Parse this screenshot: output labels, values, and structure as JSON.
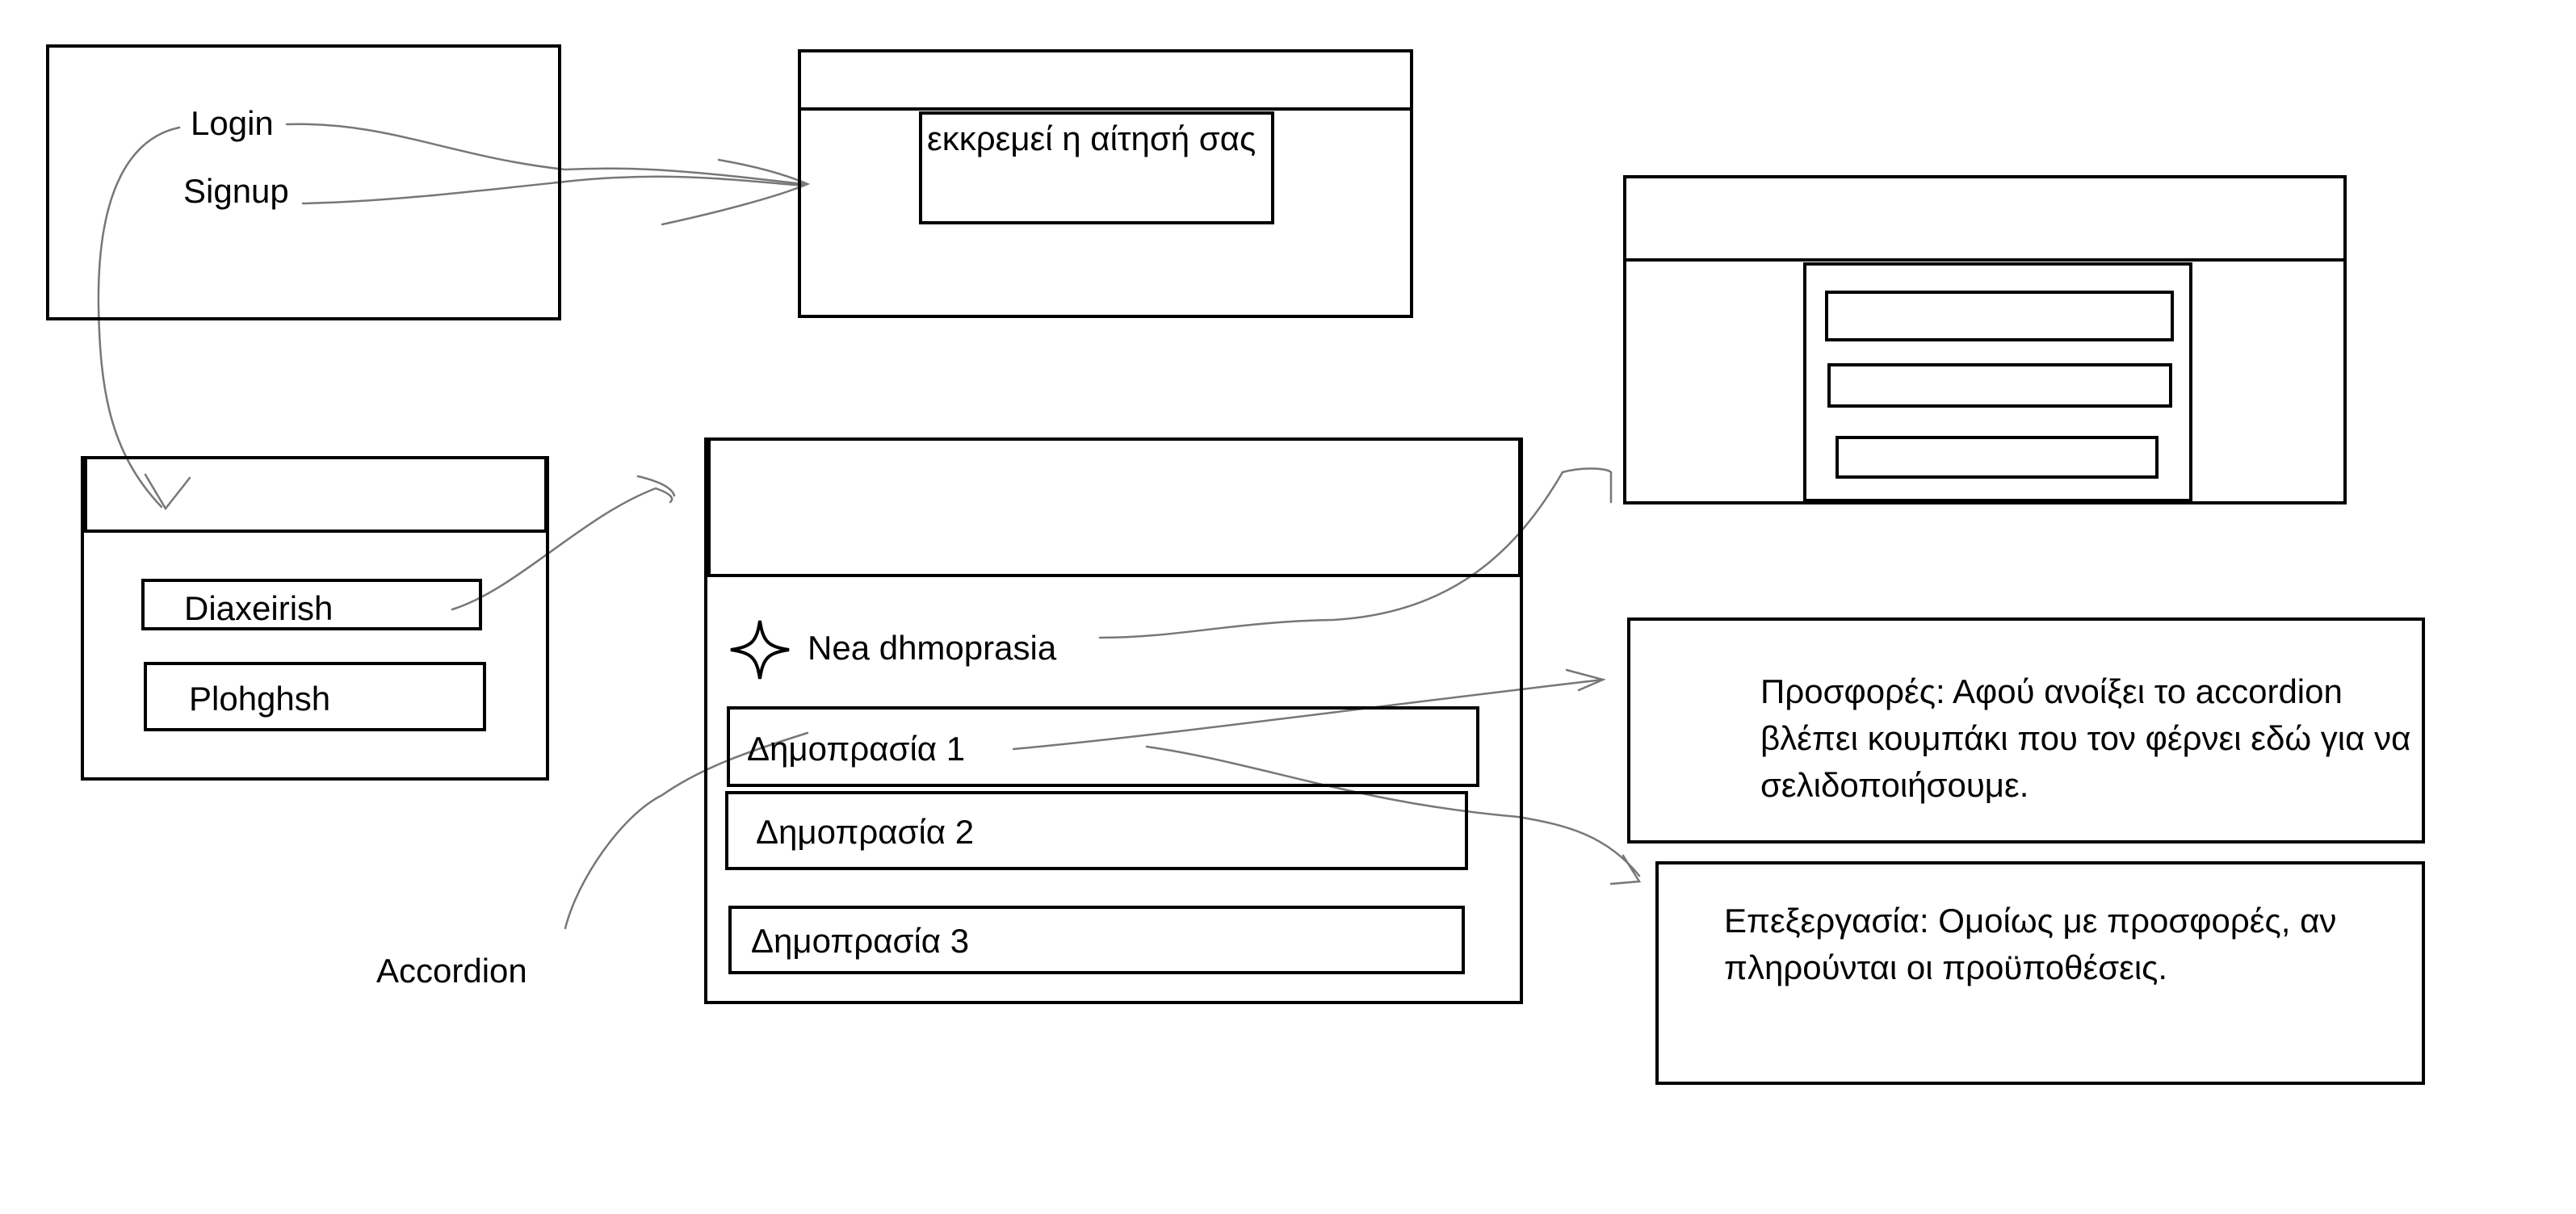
{
  "start_screen": {
    "login_label": "Login",
    "signup_label": "Signup"
  },
  "pending_screen": {
    "pending_message": "εκκρεμεί η αίτησή σας"
  },
  "role_screen": {
    "admin_button": "Diaxeirish",
    "browse_button": "Plohghsh"
  },
  "auction_screen": {
    "new_auction_label": "Nea dhmoprasia",
    "new_auction_icon": "sparkle-icon",
    "accordion_items": [
      "Δημοπρασία 1",
      "Δημοπρασία 2",
      "Δημοπρασία 3"
    ],
    "accordion_annotation": "Accordion"
  },
  "notes": {
    "offers_note": [
      "Προσφορές: Αφού ανοίξει το accordion",
      "βλέπει κουμπάκι που τον φέρνει εδώ για να",
      "σελιδοποιήσουμε."
    ],
    "edit_note": [
      "Επεξεργασία: Ομοίως με προσφορές, αν",
      "πληρούνται οι προϋποθέσεις."
    ]
  }
}
